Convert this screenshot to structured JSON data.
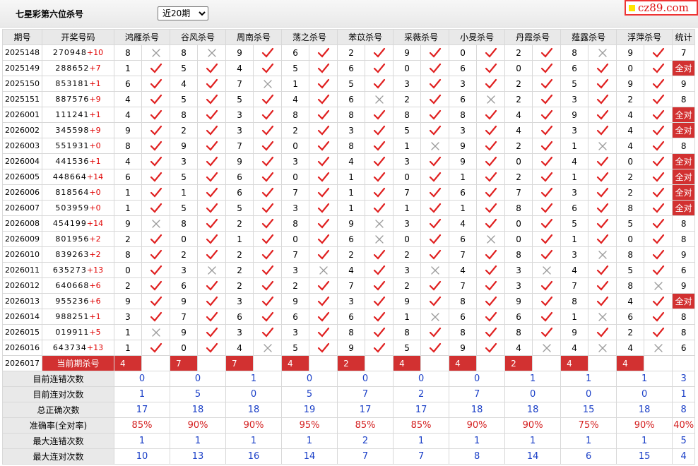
{
  "header": {
    "title": "七星彩第六位杀号",
    "period_selected": "近20期",
    "period_options": [
      "近20期"
    ],
    "site": "cz89.com"
  },
  "columns": {
    "issue": "期号",
    "draw": "开奖号码",
    "experts": [
      "鸿雁杀号",
      "谷风杀号",
      "周南杀号",
      "荡之杀号",
      "苯苡杀号",
      "采薇杀号",
      "小旻杀号",
      "丹霞杀号",
      "薤露杀号",
      "浮萍杀号"
    ],
    "stat": "统计"
  },
  "rows": [
    {
      "issue": "2025148",
      "draw": "270948",
      "extra": "+10",
      "stat": "7",
      "cells": [
        [
          "8",
          "x"
        ],
        [
          "8",
          "x"
        ],
        [
          "9",
          "v"
        ],
        [
          "6",
          "v"
        ],
        [
          "2",
          "v"
        ],
        [
          "9",
          "v"
        ],
        [
          "0",
          "v"
        ],
        [
          "2",
          "v"
        ],
        [
          "8",
          "x"
        ],
        [
          "9",
          "v"
        ]
      ]
    },
    {
      "issue": "2025149",
      "draw": "288652",
      "extra": "+7",
      "stat": "全对",
      "cells": [
        [
          "1",
          "v"
        ],
        [
          "5",
          "v"
        ],
        [
          "4",
          "v"
        ],
        [
          "5",
          "v"
        ],
        [
          "6",
          "v"
        ],
        [
          "0",
          "v"
        ],
        [
          "6",
          "v"
        ],
        [
          "0",
          "v"
        ],
        [
          "6",
          "v"
        ],
        [
          "0",
          "v"
        ]
      ]
    },
    {
      "issue": "2025150",
      "draw": "853181",
      "extra": "+1",
      "stat": "9",
      "cells": [
        [
          "6",
          "v"
        ],
        [
          "4",
          "v"
        ],
        [
          "7",
          "x"
        ],
        [
          "1",
          "v"
        ],
        [
          "5",
          "v"
        ],
        [
          "3",
          "v"
        ],
        [
          "3",
          "v"
        ],
        [
          "2",
          "v"
        ],
        [
          "5",
          "v"
        ],
        [
          "9",
          "v"
        ]
      ]
    },
    {
      "issue": "2025151",
      "draw": "887576",
      "extra": "+9",
      "stat": "8",
      "cells": [
        [
          "4",
          "v"
        ],
        [
          "5",
          "v"
        ],
        [
          "5",
          "v"
        ],
        [
          "4",
          "v"
        ],
        [
          "6",
          "x"
        ],
        [
          "2",
          "v"
        ],
        [
          "6",
          "x"
        ],
        [
          "2",
          "v"
        ],
        [
          "3",
          "v"
        ],
        [
          "2",
          "v"
        ]
      ]
    },
    {
      "issue": "2026001",
      "draw": "111241",
      "extra": "+1",
      "stat": "全对",
      "cells": [
        [
          "4",
          "v"
        ],
        [
          "8",
          "v"
        ],
        [
          "3",
          "v"
        ],
        [
          "8",
          "v"
        ],
        [
          "8",
          "v"
        ],
        [
          "8",
          "v"
        ],
        [
          "8",
          "v"
        ],
        [
          "4",
          "v"
        ],
        [
          "9",
          "v"
        ],
        [
          "4",
          "v"
        ]
      ]
    },
    {
      "issue": "2026002",
      "draw": "345598",
      "extra": "+9",
      "stat": "全对",
      "cells": [
        [
          "9",
          "v"
        ],
        [
          "2",
          "v"
        ],
        [
          "3",
          "v"
        ],
        [
          "2",
          "v"
        ],
        [
          "3",
          "v"
        ],
        [
          "5",
          "v"
        ],
        [
          "3",
          "v"
        ],
        [
          "4",
          "v"
        ],
        [
          "3",
          "v"
        ],
        [
          "4",
          "v"
        ]
      ]
    },
    {
      "issue": "2026003",
      "draw": "551931",
      "extra": "+0",
      "stat": "8",
      "cells": [
        [
          "8",
          "v"
        ],
        [
          "9",
          "v"
        ],
        [
          "7",
          "v"
        ],
        [
          "0",
          "v"
        ],
        [
          "8",
          "v"
        ],
        [
          "1",
          "x"
        ],
        [
          "9",
          "v"
        ],
        [
          "2",
          "v"
        ],
        [
          "1",
          "x"
        ],
        [
          "4",
          "v"
        ]
      ]
    },
    {
      "issue": "2026004",
      "draw": "441536",
      "extra": "+1",
      "stat": "全对",
      "cells": [
        [
          "4",
          "v"
        ],
        [
          "3",
          "v"
        ],
        [
          "9",
          "v"
        ],
        [
          "3",
          "v"
        ],
        [
          "4",
          "v"
        ],
        [
          "3",
          "v"
        ],
        [
          "9",
          "v"
        ],
        [
          "0",
          "v"
        ],
        [
          "4",
          "v"
        ],
        [
          "0",
          "v"
        ]
      ]
    },
    {
      "issue": "2026005",
      "draw": "448664",
      "extra": "+14",
      "stat": "全对",
      "cells": [
        [
          "6",
          "v"
        ],
        [
          "5",
          "v"
        ],
        [
          "6",
          "v"
        ],
        [
          "0",
          "v"
        ],
        [
          "1",
          "v"
        ],
        [
          "0",
          "v"
        ],
        [
          "1",
          "v"
        ],
        [
          "2",
          "v"
        ],
        [
          "1",
          "v"
        ],
        [
          "2",
          "v"
        ]
      ]
    },
    {
      "issue": "2026006",
      "draw": "818564",
      "extra": "+0",
      "stat": "全对",
      "cells": [
        [
          "1",
          "v"
        ],
        [
          "1",
          "v"
        ],
        [
          "6",
          "v"
        ],
        [
          "7",
          "v"
        ],
        [
          "1",
          "v"
        ],
        [
          "7",
          "v"
        ],
        [
          "6",
          "v"
        ],
        [
          "7",
          "v"
        ],
        [
          "3",
          "v"
        ],
        [
          "2",
          "v"
        ]
      ]
    },
    {
      "issue": "2026007",
      "draw": "503959",
      "extra": "+0",
      "stat": "全对",
      "cells": [
        [
          "1",
          "v"
        ],
        [
          "5",
          "v"
        ],
        [
          "5",
          "v"
        ],
        [
          "3",
          "v"
        ],
        [
          "1",
          "v"
        ],
        [
          "1",
          "v"
        ],
        [
          "1",
          "v"
        ],
        [
          "8",
          "v"
        ],
        [
          "6",
          "v"
        ],
        [
          "8",
          "v"
        ]
      ]
    },
    {
      "issue": "2026008",
      "draw": "454199",
      "extra": "+14",
      "stat": "8",
      "cells": [
        [
          "9",
          "x"
        ],
        [
          "8",
          "v"
        ],
        [
          "2",
          "v"
        ],
        [
          "8",
          "v"
        ],
        [
          "9",
          "x"
        ],
        [
          "3",
          "v"
        ],
        [
          "4",
          "v"
        ],
        [
          "0",
          "v"
        ],
        [
          "5",
          "v"
        ],
        [
          "5",
          "v"
        ]
      ]
    },
    {
      "issue": "2026009",
      "draw": "801956",
      "extra": "+2",
      "stat": "8",
      "cells": [
        [
          "2",
          "v"
        ],
        [
          "0",
          "v"
        ],
        [
          "1",
          "v"
        ],
        [
          "0",
          "v"
        ],
        [
          "6",
          "x"
        ],
        [
          "0",
          "v"
        ],
        [
          "6",
          "x"
        ],
        [
          "0",
          "v"
        ],
        [
          "1",
          "v"
        ],
        [
          "0",
          "v"
        ]
      ]
    },
    {
      "issue": "2026010",
      "draw": "839263",
      "extra": "+2",
      "stat": "9",
      "cells": [
        [
          "8",
          "v"
        ],
        [
          "2",
          "v"
        ],
        [
          "2",
          "v"
        ],
        [
          "7",
          "v"
        ],
        [
          "2",
          "v"
        ],
        [
          "2",
          "v"
        ],
        [
          "7",
          "v"
        ],
        [
          "8",
          "v"
        ],
        [
          "3",
          "x"
        ],
        [
          "8",
          "v"
        ]
      ]
    },
    {
      "issue": "2026011",
      "draw": "635273",
      "extra": "+13",
      "stat": "6",
      "cells": [
        [
          "0",
          "v"
        ],
        [
          "3",
          "x"
        ],
        [
          "2",
          "v"
        ],
        [
          "3",
          "x"
        ],
        [
          "4",
          "v"
        ],
        [
          "3",
          "x"
        ],
        [
          "4",
          "v"
        ],
        [
          "3",
          "x"
        ],
        [
          "4",
          "v"
        ],
        [
          "5",
          "v"
        ]
      ]
    },
    {
      "issue": "2026012",
      "draw": "640668",
      "extra": "+6",
      "stat": "9",
      "cells": [
        [
          "2",
          "v"
        ],
        [
          "6",
          "v"
        ],
        [
          "2",
          "v"
        ],
        [
          "2",
          "v"
        ],
        [
          "7",
          "v"
        ],
        [
          "2",
          "v"
        ],
        [
          "7",
          "v"
        ],
        [
          "3",
          "v"
        ],
        [
          "7",
          "v"
        ],
        [
          "8",
          "x"
        ]
      ]
    },
    {
      "issue": "2026013",
      "draw": "955236",
      "extra": "+6",
      "stat": "全对",
      "cells": [
        [
          "9",
          "v"
        ],
        [
          "9",
          "v"
        ],
        [
          "3",
          "v"
        ],
        [
          "9",
          "v"
        ],
        [
          "3",
          "v"
        ],
        [
          "9",
          "v"
        ],
        [
          "8",
          "v"
        ],
        [
          "9",
          "v"
        ],
        [
          "8",
          "v"
        ],
        [
          "4",
          "v"
        ]
      ]
    },
    {
      "issue": "2026014",
      "draw": "988251",
      "extra": "+1",
      "stat": "8",
      "cells": [
        [
          "3",
          "v"
        ],
        [
          "7",
          "v"
        ],
        [
          "6",
          "v"
        ],
        [
          "6",
          "v"
        ],
        [
          "6",
          "v"
        ],
        [
          "1",
          "x"
        ],
        [
          "6",
          "v"
        ],
        [
          "6",
          "v"
        ],
        [
          "1",
          "x"
        ],
        [
          "6",
          "v"
        ]
      ]
    },
    {
      "issue": "2026015",
      "draw": "019911",
      "extra": "+5",
      "stat": "8",
      "cells": [
        [
          "1",
          "x"
        ],
        [
          "9",
          "v"
        ],
        [
          "3",
          "v"
        ],
        [
          "3",
          "v"
        ],
        [
          "8",
          "v"
        ],
        [
          "8",
          "v"
        ],
        [
          "8",
          "v"
        ],
        [
          "8",
          "v"
        ],
        [
          "9",
          "v"
        ],
        [
          "2",
          "v"
        ]
      ]
    },
    {
      "issue": "2026016",
      "draw": "643734",
      "extra": "+13",
      "stat": "6",
      "cells": [
        [
          "1",
          "v"
        ],
        [
          "0",
          "v"
        ],
        [
          "4",
          "x"
        ],
        [
          "5",
          "v"
        ],
        [
          "9",
          "v"
        ],
        [
          "5",
          "v"
        ],
        [
          "9",
          "v"
        ],
        [
          "4",
          "x"
        ],
        [
          "4",
          "x"
        ],
        [
          "4",
          "x"
        ]
      ]
    }
  ],
  "current": {
    "issue": "2026017",
    "label": "当前期杀号",
    "kills": [
      "4",
      "7",
      "7",
      "4",
      "2",
      "4",
      "4",
      "2",
      "4",
      "4"
    ]
  },
  "summary": [
    {
      "label": "目前连错次数",
      "values": [
        "0",
        "0",
        "1",
        "0",
        "0",
        "0",
        "0",
        "1",
        "1",
        "1"
      ],
      "stat": "3"
    },
    {
      "label": "目前连对次数",
      "values": [
        "1",
        "5",
        "0",
        "5",
        "7",
        "2",
        "7",
        "0",
        "0",
        "0"
      ],
      "stat": "1"
    },
    {
      "label": "总正确次数",
      "values": [
        "17",
        "18",
        "18",
        "19",
        "17",
        "17",
        "18",
        "18",
        "15",
        "18"
      ],
      "stat": "8"
    },
    {
      "label": "准确率(全对率)",
      "values": [
        "85%",
        "90%",
        "90%",
        "95%",
        "85%",
        "85%",
        "90%",
        "90%",
        "75%",
        "90%"
      ],
      "stat": "40%"
    },
    {
      "label": "最大连错次数",
      "values": [
        "1",
        "1",
        "1",
        "1",
        "2",
        "1",
        "1",
        "1",
        "1",
        "1"
      ],
      "stat": "5"
    },
    {
      "label": "最大连对次数",
      "values": [
        "10",
        "13",
        "16",
        "14",
        "7",
        "7",
        "8",
        "14",
        "6",
        "15"
      ],
      "stat": "4"
    }
  ],
  "colors": {
    "check": "#e02020",
    "cross": "#9a9a9a",
    "red_badge": "#d23131",
    "blue_value": "#1a3fc7"
  },
  "icons": {
    "correct": "check-icon",
    "wrong": "cross-icon"
  }
}
